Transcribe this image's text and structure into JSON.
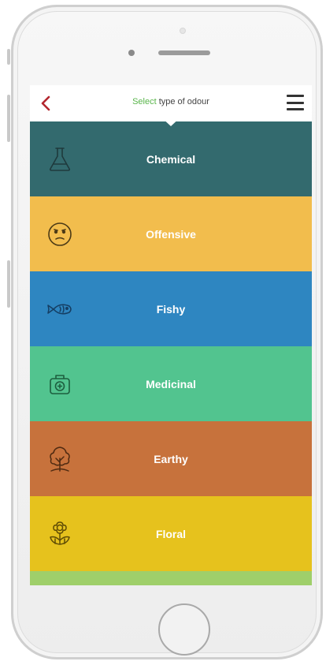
{
  "header": {
    "title_accent": "Select",
    "title_rest": " type of odour"
  },
  "odours": [
    {
      "label": "Chemical",
      "icon": "flask-icon",
      "color": "#336a6e",
      "icon_color": "#1f3a3d"
    },
    {
      "label": "Offensive",
      "icon": "face-icon",
      "color": "#f2bd4d",
      "icon_color": "#4b3a16"
    },
    {
      "label": "Fishy",
      "icon": "fish-icon",
      "color": "#2e86c1",
      "icon_color": "#153e63"
    },
    {
      "label": "Medicinal",
      "icon": "medical-kit-icon",
      "color": "#52c48f",
      "icon_color": "#1d5e3f"
    },
    {
      "label": "Earthy",
      "icon": "tree-icon",
      "color": "#c7723c",
      "icon_color": "#4f2a11"
    },
    {
      "label": "Floral",
      "icon": "flower-icon",
      "color": "#e6c21d",
      "icon_color": "#5f4c05"
    }
  ],
  "partial_row_color": "#9fcf6a",
  "accent_color": "#58b54a",
  "back_color": "#b3262e"
}
